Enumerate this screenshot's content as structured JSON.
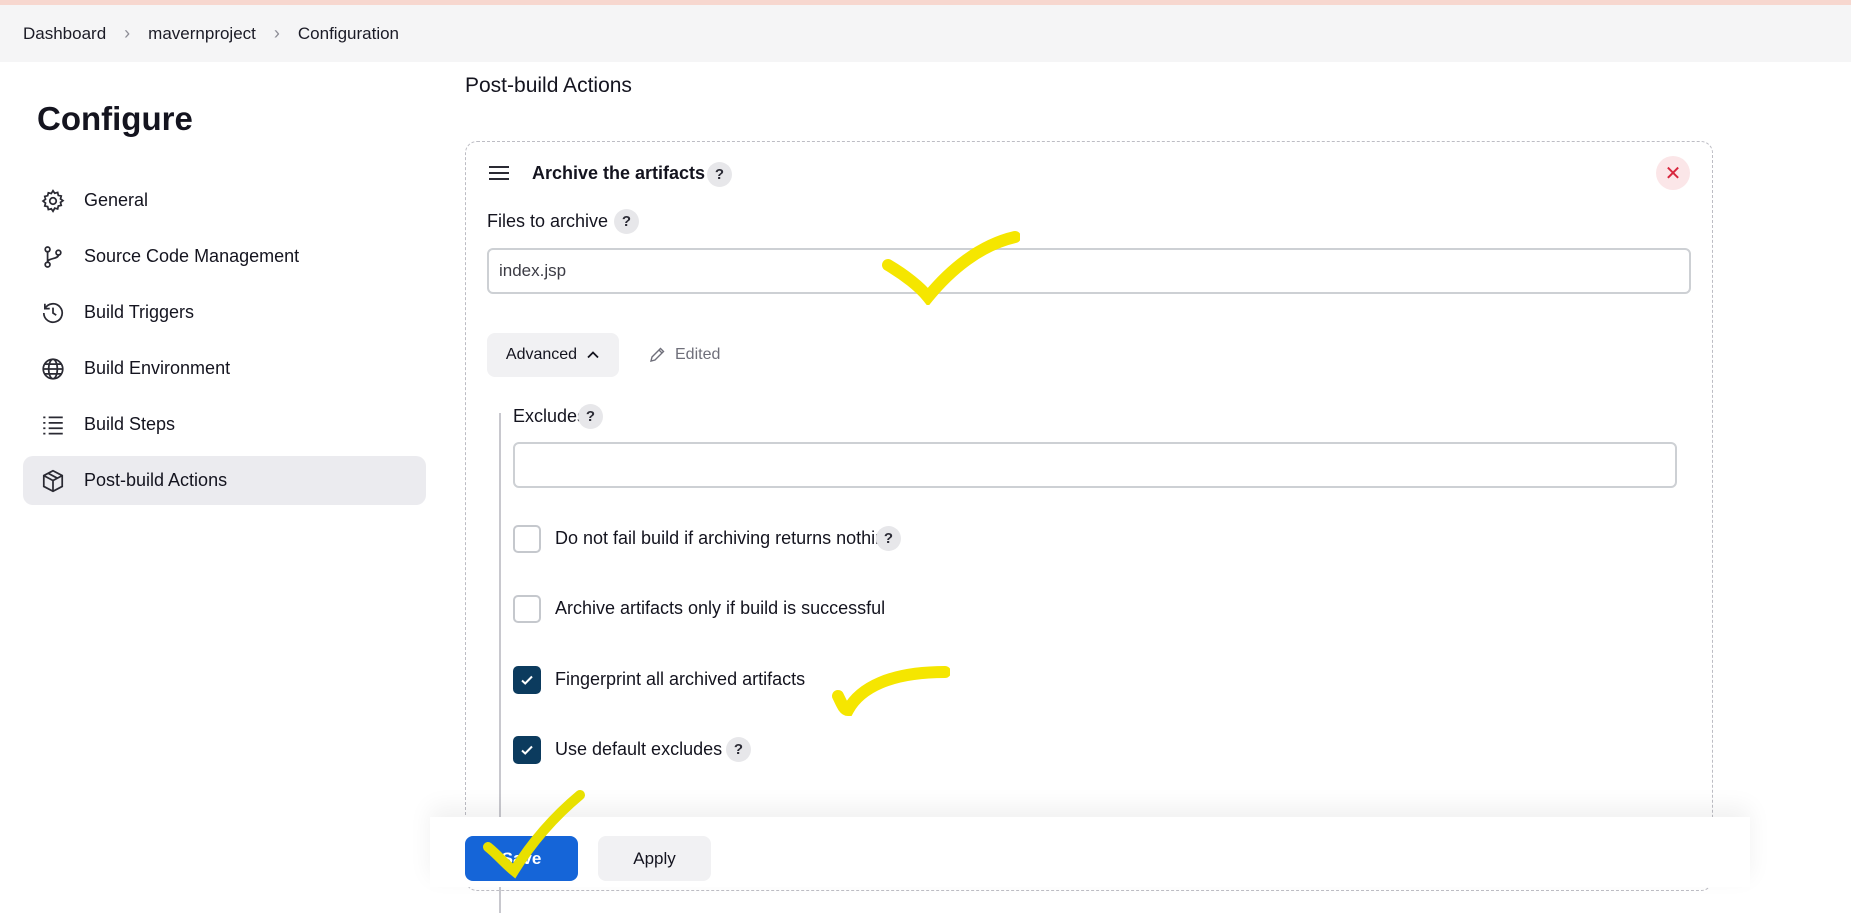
{
  "breadcrumb": {
    "items": [
      "Dashboard",
      "mavernproject",
      "Configuration"
    ]
  },
  "sidebar": {
    "title": "Configure",
    "items": [
      {
        "label": "General",
        "icon": "gear-icon"
      },
      {
        "label": "Source Code Management",
        "icon": "branch-icon"
      },
      {
        "label": "Build Triggers",
        "icon": "clock-icon"
      },
      {
        "label": "Build Environment",
        "icon": "globe-icon"
      },
      {
        "label": "Build Steps",
        "icon": "list-icon"
      },
      {
        "label": "Post-build Actions",
        "icon": "package-icon",
        "active": true
      }
    ]
  },
  "main": {
    "section_title": "Post-build Actions",
    "panel": {
      "title": "Archive the artifacts",
      "help": "?",
      "close_icon": "close-icon",
      "files_label": "Files to archive",
      "files_value": "index.jsp",
      "advanced_label": "Advanced",
      "edited_label": "Edited",
      "excludes_label": "Excludes",
      "excludes_value": "",
      "options": [
        {
          "label": "Do not fail build if archiving returns nothing",
          "checked": false,
          "help": true
        },
        {
          "label": "Archive artifacts only if build is successful",
          "checked": false,
          "help": false
        },
        {
          "label": "Fingerprint all archived artifacts",
          "checked": true,
          "help": false
        },
        {
          "label": "Use default excludes",
          "checked": true,
          "help": true
        }
      ]
    }
  },
  "footer": {
    "save_label": "Save",
    "apply_label": "Apply"
  },
  "colors": {
    "save_button": "#1565d8",
    "checkbox_checked": "#0c3b5e",
    "annotation_highlight": "#f5e600",
    "close_icon": "#d7263d"
  }
}
